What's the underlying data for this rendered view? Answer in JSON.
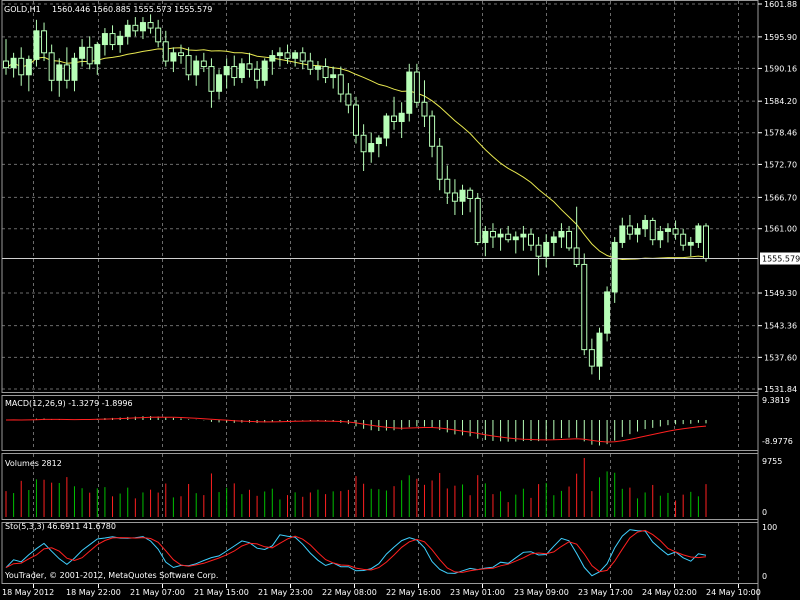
{
  "header": {
    "symbol": "GOLD,H1",
    "ohlc": "1560.446 1560.885 1555.573 1555.579"
  },
  "copyright": "YouTrader, © 2001-2012, MetaQuotes Software Corp.",
  "colors": {
    "background": "#000000",
    "grid": "#6b6b6b",
    "bull": "#b8ffb8",
    "bear": "#000000",
    "candle_border": "#b8ffb8",
    "ma": "#e8e850",
    "macd_hist": "#b8ffb8",
    "macd_signal": "#ff2020",
    "vol_up": "#00c000",
    "vol_down": "#ff2020",
    "sto_main": "#40d0ff",
    "sto_signal": "#ff2020"
  },
  "chart_data": [
    {
      "type": "candlestick",
      "title": "GOLD,H1",
      "ylim": [
        1531.84,
        1601.88
      ],
      "y_ticks": [
        "1601.88",
        "1595.90",
        "1590.16",
        "1584.20",
        "1578.46",
        "1572.70",
        "1566.70",
        "1561.00",
        "1555.579",
        "1549.30",
        "1543.36",
        "1537.60",
        "1531.84"
      ],
      "current_price": 1555.579,
      "x_ticks": [
        "18 May 2012",
        "18 May 22:00",
        "21 May 07:00",
        "21 May 15:00",
        "21 May 23:00",
        "22 May 08:00",
        "22 May 16:00",
        "23 May 01:00",
        "23 May 09:00",
        "23 May 17:00",
        "24 May 02:00",
        "24 May 10:00"
      ],
      "ohlc": [
        [
          1591.5,
          1595.5,
          1589.0,
          1590.3
        ],
        [
          1590.3,
          1593.0,
          1588.5,
          1592.0
        ],
        [
          1592.0,
          1594.0,
          1587.0,
          1589.0
        ],
        [
          1589.0,
          1592.5,
          1586.0,
          1591.8
        ],
        [
          1591.8,
          1599.0,
          1590.5,
          1597.0
        ],
        [
          1597.0,
          1598.5,
          1591.5,
          1593.0
        ],
        [
          1593.0,
          1594.5,
          1586.0,
          1588.0
        ],
        [
          1588.0,
          1592.0,
          1585.0,
          1590.8
        ],
        [
          1590.8,
          1594.0,
          1586.5,
          1588.0
        ],
        [
          1588.0,
          1593.0,
          1586.0,
          1592.0
        ],
        [
          1592.0,
          1595.5,
          1590.5,
          1594.0
        ],
        [
          1594.0,
          1596.0,
          1590.0,
          1591.0
        ],
        [
          1591.0,
          1595.0,
          1589.0,
          1594.5
        ],
        [
          1594.5,
          1597.5,
          1592.5,
          1596.5
        ],
        [
          1596.5,
          1598.0,
          1593.5,
          1594.5
        ],
        [
          1594.5,
          1597.0,
          1593.0,
          1596.0
        ],
        [
          1596.0,
          1599.0,
          1594.5,
          1598.0
        ],
        [
          1598.0,
          1599.5,
          1596.0,
          1597.0
        ],
        [
          1597.0,
          1599.5,
          1595.5,
          1598.5
        ],
        [
          1598.5,
          1600.0,
          1596.5,
          1597.5
        ],
        [
          1597.5,
          1599.0,
          1594.0,
          1595.0
        ],
        [
          1595.0,
          1597.0,
          1590.5,
          1591.5
        ],
        [
          1591.5,
          1594.0,
          1589.5,
          1593.0
        ],
        [
          1593.0,
          1594.5,
          1591.0,
          1592.5
        ],
        [
          1592.5,
          1594.0,
          1588.0,
          1589.0
        ],
        [
          1589.0,
          1592.5,
          1587.0,
          1591.5
        ],
        [
          1591.5,
          1593.0,
          1589.5,
          1590.5
        ],
        [
          1590.5,
          1592.0,
          1583.0,
          1586.0
        ],
        [
          1586.0,
          1590.0,
          1584.5,
          1589.0
        ],
        [
          1589.0,
          1592.0,
          1586.5,
          1590.5
        ],
        [
          1590.5,
          1592.5,
          1587.0,
          1588.5
        ],
        [
          1588.5,
          1592.0,
          1587.5,
          1591.0
        ],
        [
          1591.0,
          1593.0,
          1588.5,
          1590.0
        ],
        [
          1590.0,
          1591.5,
          1586.5,
          1588.0
        ],
        [
          1588.0,
          1592.0,
          1587.0,
          1591.5
        ],
        [
          1591.5,
          1593.5,
          1589.0,
          1592.5
        ],
        [
          1592.5,
          1594.0,
          1590.5,
          1593.0
        ],
        [
          1593.0,
          1594.5,
          1591.0,
          1592.0
        ],
        [
          1592.0,
          1593.5,
          1590.5,
          1593.0
        ],
        [
          1593.0,
          1594.0,
          1590.0,
          1591.5
        ],
        [
          1591.5,
          1593.0,
          1589.0,
          1590.0
        ],
        [
          1590.0,
          1591.5,
          1588.0,
          1590.5
        ],
        [
          1590.5,
          1592.0,
          1587.5,
          1588.5
        ],
        [
          1588.5,
          1590.5,
          1586.5,
          1589.0
        ],
        [
          1589.0,
          1590.5,
          1584.0,
          1585.5
        ],
        [
          1585.5,
          1587.5,
          1582.0,
          1583.5
        ],
        [
          1583.5,
          1585.0,
          1576.5,
          1578.0
        ],
        [
          1578.0,
          1580.0,
          1571.5,
          1575.0
        ],
        [
          1575.0,
          1578.5,
          1573.0,
          1576.5
        ],
        [
          1576.5,
          1578.0,
          1574.0,
          1577.5
        ],
        [
          1577.5,
          1582.0,
          1576.0,
          1581.5
        ],
        [
          1581.5,
          1585.0,
          1579.0,
          1580.5
        ],
        [
          1580.5,
          1584.0,
          1577.5,
          1582.0
        ],
        [
          1582.0,
          1591.0,
          1580.5,
          1589.5
        ],
        [
          1589.5,
          1591.0,
          1583.0,
          1584.0
        ],
        [
          1584.0,
          1588.0,
          1579.5,
          1581.5
        ],
        [
          1581.5,
          1582.5,
          1574.0,
          1576.0
        ],
        [
          1576.0,
          1577.5,
          1568.0,
          1570.0
        ],
        [
          1570.0,
          1572.5,
          1565.5,
          1567.5
        ],
        [
          1567.5,
          1570.0,
          1563.5,
          1566.0
        ],
        [
          1566.0,
          1569.0,
          1563.5,
          1568.0
        ],
        [
          1568.0,
          1568.5,
          1564.0,
          1566.5
        ],
        [
          1566.5,
          1567.5,
          1558.0,
          1558.5
        ],
        [
          1558.5,
          1561.5,
          1556.0,
          1560.5
        ],
        [
          1560.5,
          1562.0,
          1557.5,
          1559.5
        ],
        [
          1559.5,
          1561.0,
          1557.0,
          1560.0
        ],
        [
          1560.0,
          1561.5,
          1558.5,
          1559.0
        ],
        [
          1559.0,
          1560.5,
          1556.5,
          1559.5
        ],
        [
          1559.5,
          1561.5,
          1557.0,
          1560.0
        ],
        [
          1560.0,
          1561.0,
          1557.0,
          1558.0
        ],
        [
          1558.0,
          1559.5,
          1552.5,
          1556.0
        ],
        [
          1556.0,
          1560.0,
          1554.0,
          1558.5
        ],
        [
          1558.5,
          1560.5,
          1556.0,
          1559.5
        ],
        [
          1559.5,
          1562.0,
          1557.5,
          1560.5
        ],
        [
          1560.5,
          1561.5,
          1557.0,
          1557.5
        ],
        [
          1557.5,
          1565.0,
          1554.0,
          1554.5
        ],
        [
          1554.5,
          1556.5,
          1538.0,
          1539.0
        ],
        [
          1539.0,
          1541.0,
          1534.5,
          1536.0
        ],
        [
          1536.0,
          1543.0,
          1533.5,
          1542.0
        ],
        [
          1542.0,
          1550.5,
          1540.5,
          1549.5
        ],
        [
          1549.5,
          1559.5,
          1547.5,
          1558.5
        ],
        [
          1558.5,
          1563.0,
          1557.5,
          1561.5
        ],
        [
          1561.5,
          1563.5,
          1559.0,
          1560.0
        ],
        [
          1560.0,
          1562.0,
          1558.5,
          1561.0
        ],
        [
          1561.0,
          1563.5,
          1559.5,
          1562.5
        ],
        [
          1562.5,
          1563.0,
          1558.0,
          1559.0
        ],
        [
          1559.0,
          1561.5,
          1557.5,
          1560.5
        ],
        [
          1560.5,
          1562.0,
          1558.5,
          1561.0
        ],
        [
          1561.0,
          1562.5,
          1559.0,
          1560.0
        ],
        [
          1560.0,
          1561.0,
          1557.0,
          1558.0
        ],
        [
          1558.0,
          1559.5,
          1556.0,
          1558.5
        ],
        [
          1558.5,
          1562.0,
          1557.5,
          1561.5
        ],
        [
          1561.5,
          1562.0,
          1555.0,
          1555.579
        ]
      ],
      "ma_period_label": ""
    },
    {
      "type": "macd",
      "label": "MACD(12,26,9) -1.3279 -1.8996",
      "ylim": [
        -8.9776,
        9.3819
      ],
      "y_ticks": [
        "9.3819",
        "0",
        "-8.9776"
      ]
    },
    {
      "type": "volume",
      "label": "Volumes 2812",
      "ylim": [
        0,
        9755
      ],
      "y_ticks": [
        "9755",
        "0"
      ]
    },
    {
      "type": "stochastic",
      "label": "Sto(5,3,3) 46.6911 41.6780",
      "ylim": [
        0,
        100
      ],
      "y_ticks": [
        "100",
        "0"
      ]
    }
  ]
}
